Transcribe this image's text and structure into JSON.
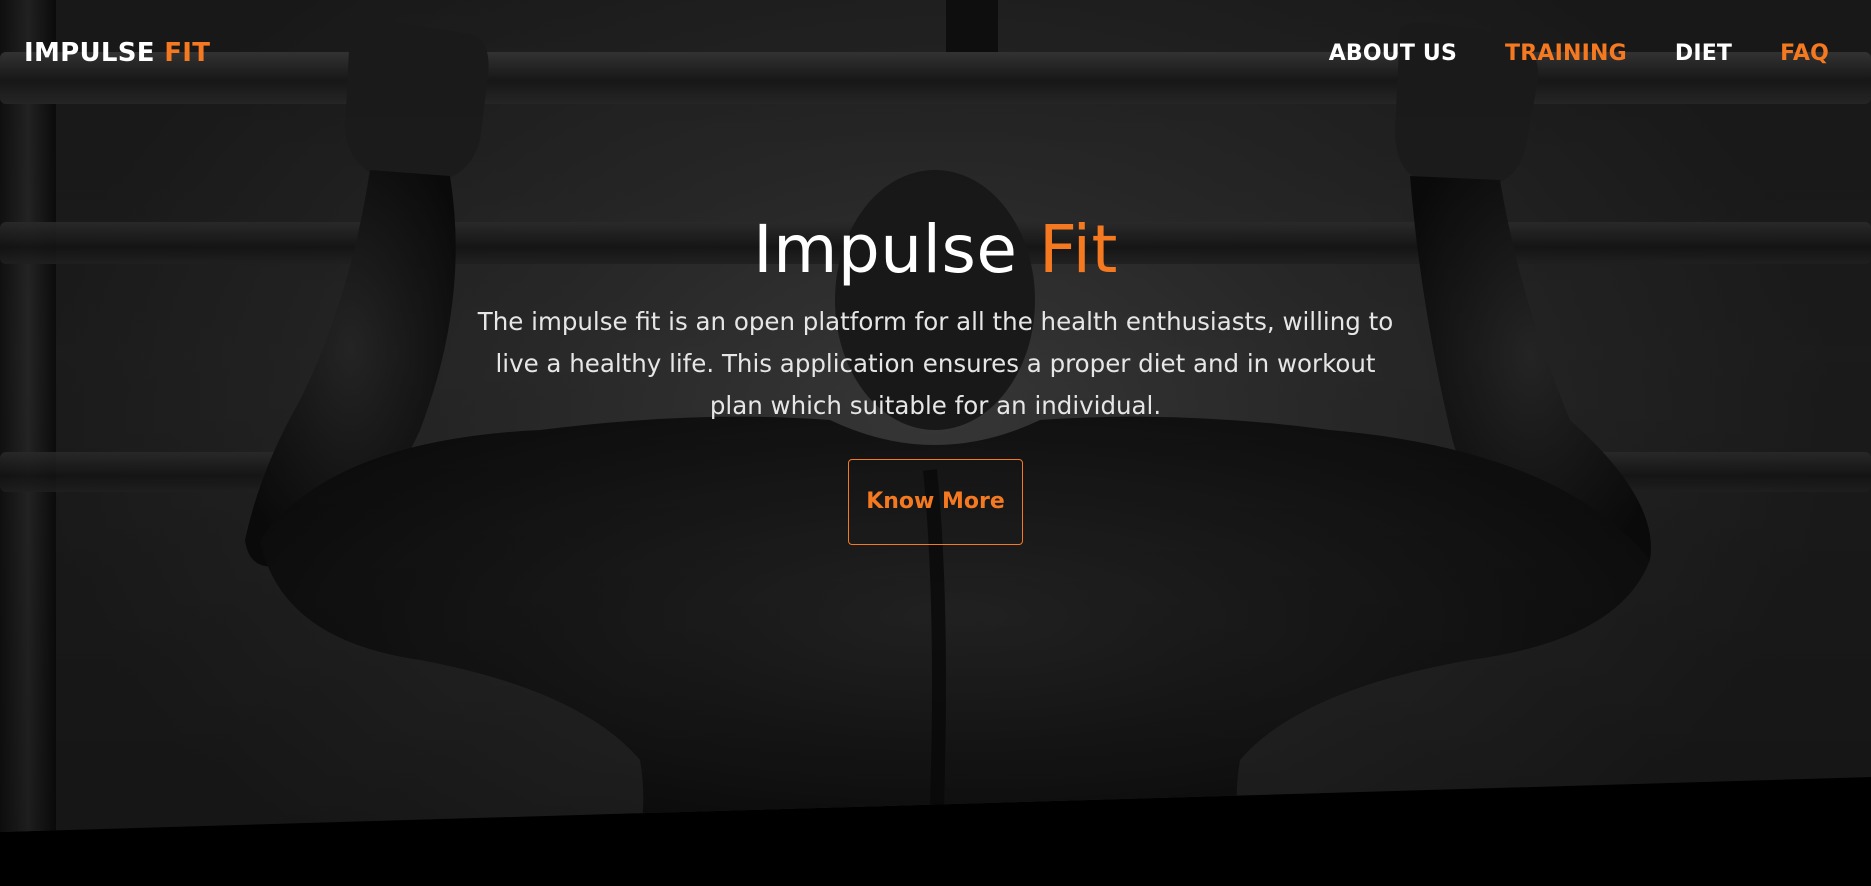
{
  "brand": {
    "name": "IMPULSE",
    "accent": "FIT"
  },
  "nav": {
    "items": [
      {
        "label": "ABOUT US",
        "color": "#ffffff"
      },
      {
        "label": "TRAINING",
        "color": "#f47920"
      },
      {
        "label": "DIET",
        "color": "#ffffff"
      },
      {
        "label": "FAQ",
        "color": "#f47920"
      }
    ]
  },
  "hero": {
    "title_main": "Impulse",
    "title_accent": "Fit",
    "description": "The impulse fit is an open platform for all the health enthusiasts, willing to live a healthy life. This application ensures a proper diet and in workout plan which suitable for an individual.",
    "cta_label": "Know More"
  },
  "colors": {
    "accent": "#f47920",
    "text": "#ffffff",
    "background": "#000000"
  }
}
